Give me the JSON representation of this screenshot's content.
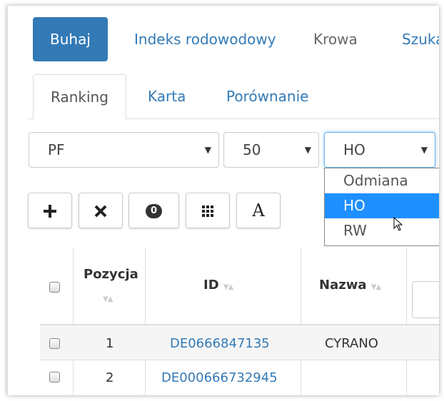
{
  "nav": {
    "pills": [
      {
        "label": "Buhaj"
      },
      {
        "label": "Indeks rodowodowy"
      },
      {
        "label": "Krowa"
      },
      {
        "label": "Szuka"
      }
    ]
  },
  "tabs": [
    {
      "label": "Ranking"
    },
    {
      "label": "Karta"
    },
    {
      "label": "Porównanie"
    }
  ],
  "filters": {
    "trait": {
      "value": "PF"
    },
    "count": {
      "value": "50"
    },
    "breed": {
      "value": "HO",
      "options": [
        {
          "label": "Odmiana"
        },
        {
          "label": "HO"
        },
        {
          "label": "RW"
        }
      ],
      "highlighted": "HO"
    }
  },
  "toolbar": {
    "add_icon": "plus-icon",
    "clear_icon": "x-icon",
    "selected_count": "0",
    "columns_icon": "grid-icon",
    "font_label": "A"
  },
  "table": {
    "headers": {
      "position": "Pozycja",
      "id": "ID",
      "name": "Nazwa"
    },
    "rows": [
      {
        "position": "1",
        "id": "DE0666847135",
        "name": "CYRANO"
      },
      {
        "position": "2",
        "id": "DE000666732945",
        "name": ""
      }
    ]
  },
  "colors": {
    "primary": "#337ab7",
    "highlight": "#1e90ff"
  }
}
